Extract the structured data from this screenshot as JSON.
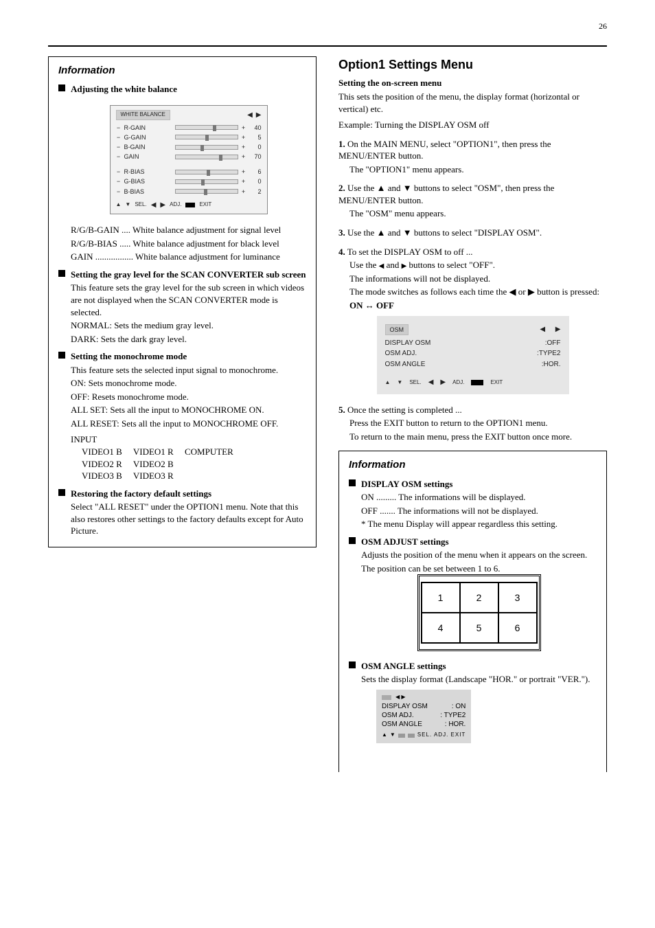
{
  "page_number": "26",
  "left": {
    "info_heading": "Information",
    "items": [
      {
        "title": "Adjusting the white balance",
        "osd": {
          "tab": "WHITE BALANCE",
          "rows": [
            {
              "name": "R-GAIN",
              "val": "40"
            },
            {
              "name": "G-GAIN",
              "val": "5"
            },
            {
              "name": "B-GAIN",
              "val": "0"
            },
            {
              "name": "GAIN",
              "val": "70"
            },
            {
              "name": "R-BIAS",
              "val": "6"
            },
            {
              "name": "G-BIAS",
              "val": "0"
            },
            {
              "name": "B-BIAS",
              "val": "2"
            }
          ],
          "footer_sel": "SEL.",
          "footer_adj": "ADJ.",
          "footer_exit": "EXIT"
        },
        "lines": [
          "R/G/B-GAIN ....  White balance adjustment for signal level",
          "R/G/B-BIAS .....  White balance adjustment for black level",
          "GAIN .................  White balance adjustment for luminance"
        ]
      },
      {
        "title": "Setting the gray level for the SCAN CONVERTER sub screen",
        "desc": "This feature sets the gray level for the sub screen in which videos are not displayed when the SCAN CONVERTER mode is selected.",
        "opts": [
          "NORMAL: Sets the medium gray level.",
          "DARK: Sets the dark gray level."
        ]
      },
      {
        "title": "Setting the monochrome mode",
        "desc": "This feature sets the selected input signal to monochrome.",
        "opts": [
          "ON: Sets monochrome mode.",
          "OFF: Resets monochrome mode."
        ],
        "extras": [
          "ALL SET: Sets all the input to MONOCHROME ON.",
          "ALL RESET: Sets all the input to MONOCHROME OFF."
        ],
        "input_label": "INPUT",
        "input_rows": [
          [
            "VIDEO1 B",
            "VIDEO1 R",
            "COMPUTER"
          ],
          [
            "VIDEO2 R",
            "VIDEO2 B",
            ""
          ],
          [
            "VIDEO3 B",
            "VIDEO3 R",
            ""
          ]
        ]
      },
      {
        "title": "Restoring the factory default settings",
        "desc": "Select \"ALL RESET\" under the OPTION1 menu. Note that this also restores other settings to the factory defaults except for Auto Picture."
      }
    ]
  },
  "right": {
    "title": "Option1 Settings Menu",
    "sub_heading": "Setting the on-screen menu",
    "intro": "This sets the position of the menu, the display format (horizontal or vertical) etc.",
    "example_label": "Example: Turning the DISPLAY OSM off",
    "steps": [
      {
        "n": "1.",
        "text": "On the MAIN MENU, select \"OPTION1\", then press the MENU/ENTER button.",
        "note": "The \"OPTION1\" menu appears."
      },
      {
        "n": "2.",
        "text_pre": "Use the ▲ and ▼ buttons to select \"OSM\", then press the MENU/ENTER button.",
        "note": "The \"OSM\" menu appears."
      },
      {
        "n": "3.",
        "text": "Use the ▲ and ▼ buttons to select \"DISPLAY OSM\"."
      },
      {
        "n": "4.",
        "text": "To set the DISPLAY OSM to off ...",
        "sub": "Use the  ◀  and  ▶  buttons to select \"OFF\".",
        "tail": "The informations will not be displayed.",
        "arrows_note": "The mode switches as follows each time the  ◀  or  ▶ button is pressed:",
        "toggle": "ON ↔ OFF"
      },
      {
        "n": "5.",
        "text": "Once the setting is completed ...",
        "sub": "Press the EXIT button to return to the OPTION1 menu.",
        "tail": "To return to the main menu, press the EXIT button once more."
      }
    ],
    "osd_big": {
      "tab": "OSM",
      "rows": [
        {
          "name": "DISPLAY OSM",
          "val": "OFF"
        },
        {
          "name": "OSM ADJ.",
          "val": "TYPE2"
        },
        {
          "name": "OSM ANGLE",
          "val": "HOR."
        }
      ],
      "footer_sel": "SEL.",
      "footer_adj": "ADJ.",
      "footer_exit": "EXIT"
    },
    "info_heading": "Information",
    "info_items": [
      {
        "title": "DISPLAY OSM settings",
        "opts": [
          "ON ......... The informations will be displayed.",
          "OFF ....... The informations will not be displayed."
        ],
        "note": "* The menu Display will appear regardless this setting."
      },
      {
        "title": "OSM ADJUST settings",
        "desc": "Adjusts the position of the menu when it appears on the screen.",
        "desc2": "The position can be set between 1 to 6."
      },
      {
        "title": "OSM ANGLE settings",
        "desc": "Sets the display format (Landscape \"HOR.\" or portrait \"VER.\").",
        "small_rows": [
          {
            "name": "DISPLAY OSM",
            "val": "ON"
          },
          {
            "name": "OSM ADJ.",
            "val": "TYPE2"
          },
          {
            "name": "OSM ANGLE",
            "val": "HOR."
          }
        ],
        "footer": "SEL.   ADJ.   EXIT"
      }
    ],
    "screen_ids": [
      "1",
      "2",
      "3",
      "4",
      "5",
      "6"
    ]
  }
}
